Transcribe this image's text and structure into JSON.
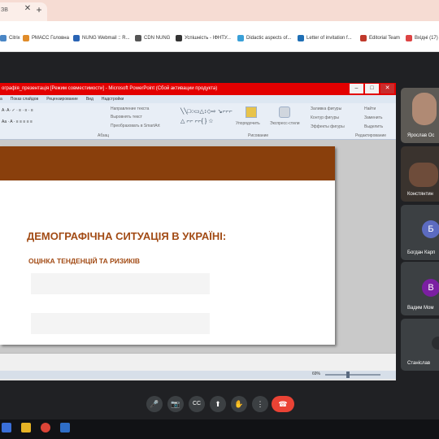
{
  "browser": {
    "tab_title": "ЗВ",
    "tab_close": "✕",
    "new_tab": "+",
    "bookmarks": [
      {
        "label": "Citrix",
        "color": "#4a86c5"
      },
      {
        "label": "РМАСС Головна",
        "color": "#e08c2a"
      },
      {
        "label": "NUNG Webmail :: R...",
        "color": "#2a64b4"
      },
      {
        "label": "CDN NUNG",
        "color": "#555"
      },
      {
        "label": "Успішність - ІФНТУ...",
        "color": "#333"
      },
      {
        "label": "Didactic aspects of...",
        "color": "#3aa0d8"
      },
      {
        "label": "Letter of invitation f...",
        "color": "#1f6fb5"
      },
      {
        "label": "Editorial Team",
        "color": "#c0392b"
      },
      {
        "label": "Вхідні (17)",
        "color": "#d44"
      }
    ]
  },
  "powerpoint": {
    "title_bar": "ографія_презентація [Режим совместимости] - Microsoft PowerPoint (Сбой активации продукта)",
    "ribbon_tabs": [
      "а",
      "Показ слайдов",
      "Рецензирование",
      "Вид",
      "Надстройки"
    ],
    "ribbon_groups": {
      "paragraph": "Абзац",
      "drawing": "Рисование",
      "editing": "Редактирование",
      "text_direction": "Направление текста",
      "align_text": "Выровнять текст",
      "convert_smartart": "Преобразовать в SmartArt",
      "arrange": "Упорядочить",
      "quick_styles": "Экспресс-стили",
      "shape_fill": "Заливка фигуры",
      "shape_outline": "Контур фигуры",
      "shape_effects": "Эффекты фигуры",
      "find": "Найти",
      "replace": "Заменить",
      "select": "Выделить"
    },
    "slide": {
      "title": "ДЕМОГРАФІЧНА СИТУАЦІЯ В УКРАЇНІ:",
      "subtitle": "ОЦІНКА ТЕНДЕНЦІЙ ТА РИЗИКІВ"
    },
    "status": {
      "zoom": "69%"
    }
  },
  "participants": [
    {
      "name": "Ярослав Ос",
      "type": "video"
    },
    {
      "name": "Констянтин",
      "type": "video"
    },
    {
      "name": "Богдан Карп",
      "initial": "Б",
      "color": "#5c6bc0"
    },
    {
      "name": "Вадим Мом",
      "initial": "В",
      "color": "#7b1fa2"
    },
    {
      "name": "Станіслав",
      "initial": "",
      "color": "#3c4043"
    }
  ],
  "controls": {
    "mic": "🎤",
    "camera": "📷",
    "captions": "CC",
    "present": "⬆",
    "raise_hand": "✋",
    "more": "⋮",
    "hangup": "☎"
  },
  "taskbar": {
    "icons": [
      {
        "name": "save",
        "color": "#3a6fd8"
      },
      {
        "name": "folder",
        "color": "#e6b325"
      },
      {
        "name": "chrome",
        "color": "#db4437"
      },
      {
        "name": "app",
        "color": "#2f6ec7"
      }
    ]
  }
}
